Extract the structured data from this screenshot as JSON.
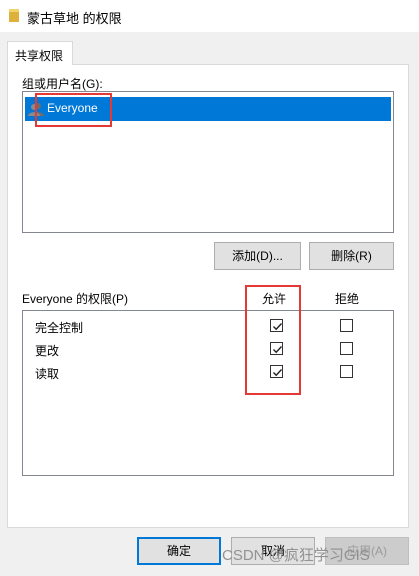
{
  "window": {
    "title": "蒙古草地 的权限"
  },
  "tabs": [
    {
      "label": "共享权限"
    }
  ],
  "groups": {
    "label": "组或用户名(G):",
    "items": [
      {
        "name": "Everyone",
        "selected": true
      }
    ]
  },
  "buttons": {
    "add": "添加(D)...",
    "remove": "删除(R)"
  },
  "permissions": {
    "label": "Everyone 的权限(P)",
    "allow_header": "允许",
    "deny_header": "拒绝",
    "rows": [
      {
        "name": "完全控制",
        "allow": true,
        "deny": false
      },
      {
        "name": "更改",
        "allow": true,
        "deny": false
      },
      {
        "name": "读取",
        "allow": true,
        "deny": false
      }
    ]
  },
  "footer": {
    "ok": "确定",
    "cancel": "取消",
    "apply": "应用(A)"
  },
  "watermark": "CSDN @疯狂学习GIS",
  "colors": {
    "selection": "#0078d7",
    "highlight_box": "#e53935"
  }
}
